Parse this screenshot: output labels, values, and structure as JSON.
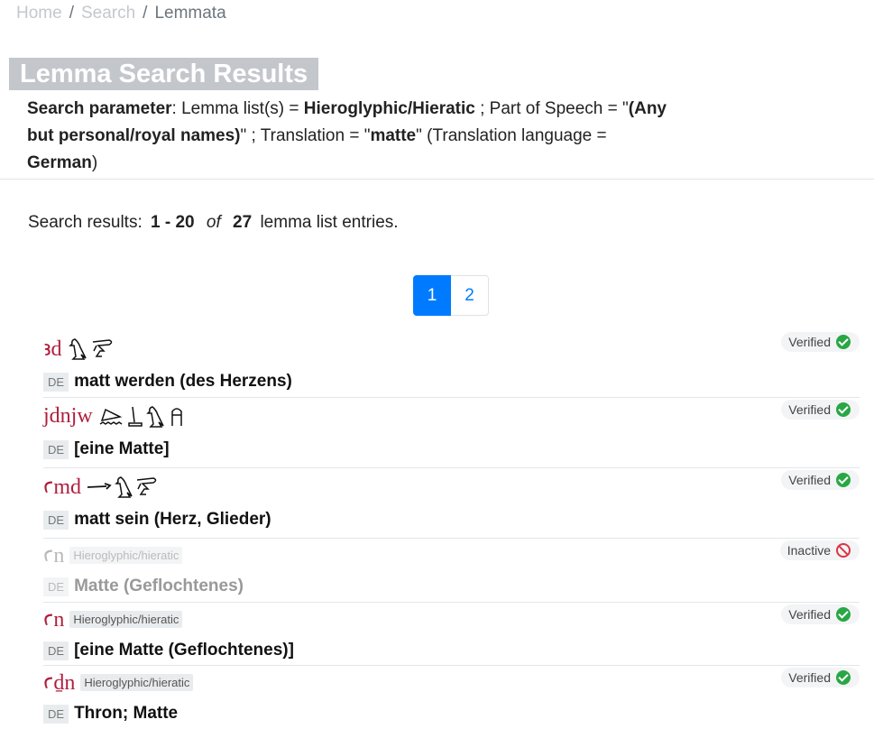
{
  "breadcrumb": {
    "home": "Home",
    "search": "Search",
    "current": "Lemmata",
    "separator": "/"
  },
  "page_title": "Lemma Search Results",
  "search_params": {
    "label": "Search parameter",
    "lemma_list_label": ": Lemma list(s) = ",
    "lemma_list_value": "Hieroglyphic/Hieratic",
    "pos_label": " ; Part of Speech = \"",
    "pos_value": "(Any but personal/royal names)",
    "translation_label": "\" ; Translation = \"",
    "translation_value": "matte",
    "translation_lang_label": "\" (Translation language = ",
    "translation_lang_value": "German",
    "close": ")"
  },
  "results": {
    "prefix": "Search results:",
    "range": "1 - 20",
    "of": "of",
    "total": "27",
    "suffix": "lemma list entries."
  },
  "pagination": {
    "pages": [
      "1",
      "2"
    ],
    "active": "1"
  },
  "entries": [
    {
      "translit": "ꜣd",
      "glyphs": [
        "vulture-glyph",
        "hand-glyph"
      ],
      "tag": "",
      "lang": "DE",
      "translation": "matt werden (des Herzens)",
      "status": "Verified",
      "status_icon": "check-circle-icon"
    },
    {
      "translit": "jdnjw",
      "glyphs": [
        "water-glyph",
        "feather-glyph",
        "bird-glyph",
        "man-glyph"
      ],
      "tag": "",
      "lang": "DE",
      "translation": "[eine Matte]",
      "status": "Verified",
      "status_icon": "check-circle-icon"
    },
    {
      "translit": "ꜥmd",
      "glyphs": [
        "arm-glyph",
        "vulture-glyph",
        "hand-glyph"
      ],
      "tag": "",
      "lang": "DE",
      "translation": "matt sein (Herz, Glieder)",
      "status": "Verified",
      "status_icon": "check-circle-icon"
    },
    {
      "translit": "ꜥn",
      "glyphs": [],
      "tag": "Hieroglyphic/hieratic",
      "lang": "DE",
      "translation": "Matte (Geflochtenes)",
      "status": "Inactive",
      "status_icon": "ban-icon"
    },
    {
      "translit": "ꜥn",
      "glyphs": [],
      "tag": "Hieroglyphic/hieratic",
      "lang": "DE",
      "translation": "[eine Matte (Geflochtenes)]",
      "status": "Verified",
      "status_icon": "check-circle-icon"
    },
    {
      "translit": "ꜥḏn",
      "glyphs": [],
      "tag": "Hieroglyphic/hieratic",
      "lang": "DE",
      "translation": "Thron; Matte",
      "status": "Verified",
      "status_icon": "check-circle-icon"
    }
  ]
}
